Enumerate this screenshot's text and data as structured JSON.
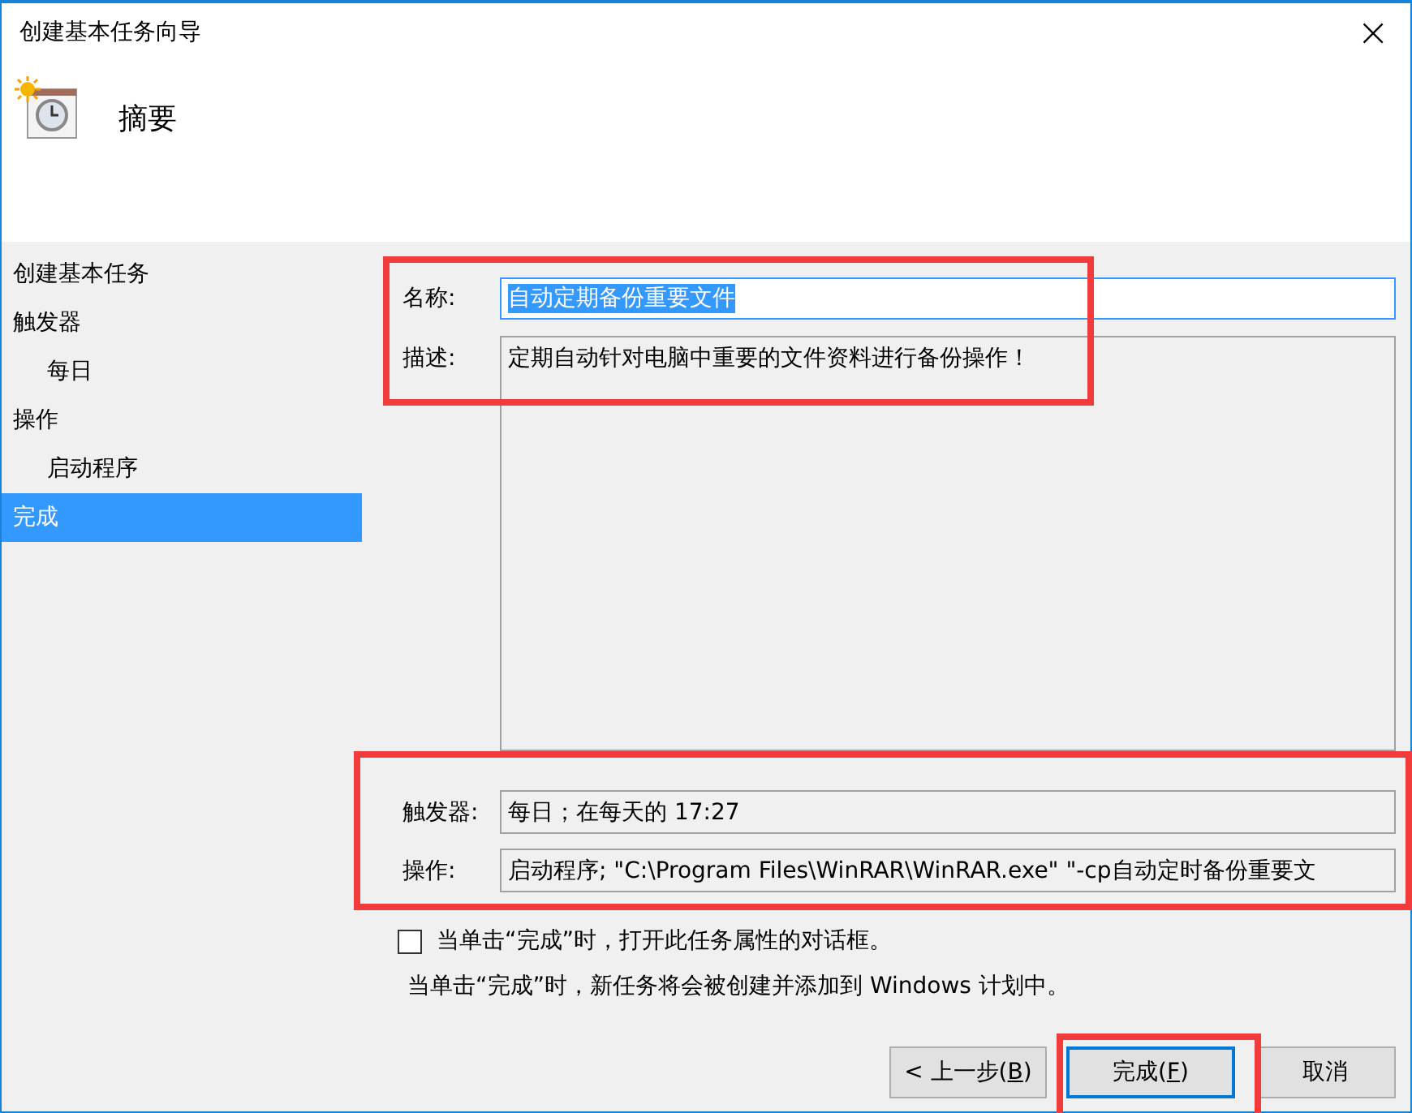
{
  "window": {
    "title": "创建基本任务向导",
    "close_glyph": "×"
  },
  "header": {
    "title": "摘要"
  },
  "sidebar": {
    "items": [
      {
        "label": "创建基本任务",
        "selected": false
      },
      {
        "label": "触发器",
        "selected": false,
        "children": [
          {
            "label": "每日",
            "selected": false
          }
        ]
      },
      {
        "label": "操作",
        "selected": false,
        "children": [
          {
            "label": "启动程序",
            "selected": false
          }
        ]
      },
      {
        "label": "完成",
        "selected": true
      }
    ]
  },
  "form": {
    "name": {
      "label": "名称:",
      "value": "自动定期备份重要文件",
      "focused": true,
      "text_selected": true
    },
    "description": {
      "label": "描述:",
      "value": "定期自动针对电脑中重要的文件资料进行备份操作！"
    },
    "trigger": {
      "label": "触发器:",
      "value": "每日；在每天的 17:27"
    },
    "action": {
      "label": "操作:",
      "value": "启动程序; \"C:\\Program Files\\WinRAR\\WinRAR.exe\"  \"-cp自动定时备份重要文"
    }
  },
  "open_properties": {
    "label": "当单击“完成”时，打开此任务属性的对话框。",
    "checked": false
  },
  "note": "当单击“完成”时，新任务将会被创建并添加到 Windows 计划中。",
  "buttons": [
    {
      "before": "< 上一步(",
      "key": "B",
      "after": ")",
      "default": false
    },
    {
      "before": "完成(",
      "key": "F",
      "after": ")",
      "default": true
    },
    {
      "before": "取消",
      "default": false
    }
  ],
  "annotations": [
    {
      "kind": "highlight-box"
    },
    {
      "kind": "highlight-box"
    },
    {
      "kind": "highlight-box"
    }
  ]
}
